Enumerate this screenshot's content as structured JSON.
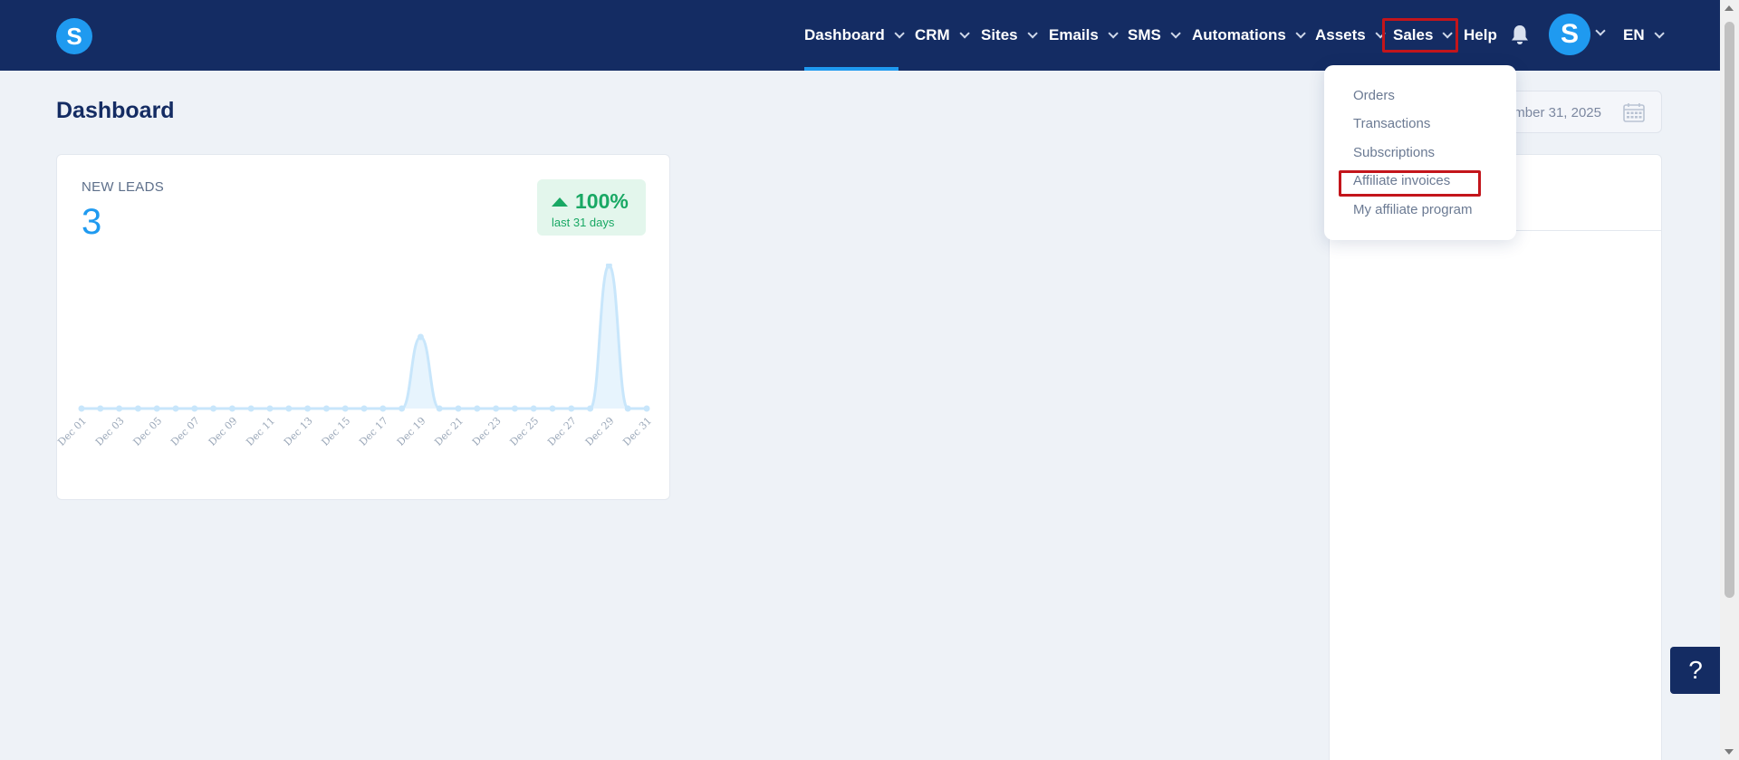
{
  "header": {
    "logo_letter": "S",
    "nav": [
      {
        "label": "Dashboard",
        "active": true
      },
      {
        "label": "CRM"
      },
      {
        "label": "Sites"
      },
      {
        "label": "Emails"
      },
      {
        "label": "SMS"
      },
      {
        "label": "Automations"
      },
      {
        "label": "Assets"
      },
      {
        "label": "Sales",
        "highlighted": true
      },
      {
        "label": "Help"
      }
    ],
    "avatar_letter": "S",
    "language": "EN"
  },
  "page": {
    "title": "Dashboard"
  },
  "date_range": {
    "visible_text": "ember 31, 2025"
  },
  "sales_menu": {
    "items": [
      {
        "label": "Orders"
      },
      {
        "label": "Transactions"
      },
      {
        "label": "Subscriptions"
      },
      {
        "label": "Affiliate invoices",
        "highlighted": true
      },
      {
        "label": "My affiliate program"
      }
    ]
  },
  "leads_card": {
    "label": "NEW LEADS",
    "value": "3",
    "change_percent": "100%",
    "change_period": "last 31 days",
    "change_direction": "up"
  },
  "help_button": {
    "label": "?"
  },
  "colors": {
    "navbar": "#142c63",
    "accent": "#1f9af0",
    "positive": "#19a864",
    "highlight": "#c3151b"
  },
  "chart_data": {
    "type": "area",
    "x": [
      "Dec 01",
      "Dec 02",
      "Dec 03",
      "Dec 04",
      "Dec 05",
      "Dec 06",
      "Dec 07",
      "Dec 08",
      "Dec 09",
      "Dec 10",
      "Dec 11",
      "Dec 12",
      "Dec 13",
      "Dec 14",
      "Dec 15",
      "Dec 16",
      "Dec 17",
      "Dec 18",
      "Dec 19",
      "Dec 20",
      "Dec 21",
      "Dec 22",
      "Dec 23",
      "Dec 24",
      "Dec 25",
      "Dec 26",
      "Dec 27",
      "Dec 28",
      "Dec 29",
      "Dec 30",
      "Dec 31"
    ],
    "tick_labels": [
      "Dec 01",
      "Dec 03",
      "Dec 05",
      "Dec 07",
      "Dec 09",
      "Dec 11",
      "Dec 13",
      "Dec 15",
      "Dec 17",
      "Dec 19",
      "Dec 21",
      "Dec 23",
      "Dec 25",
      "Dec 27",
      "Dec 29",
      "Dec 31"
    ],
    "series": [
      {
        "values": [
          0,
          0,
          0,
          0,
          0,
          0,
          0,
          0,
          0,
          0,
          0,
          0,
          0,
          0,
          0,
          0,
          0,
          0,
          1,
          0,
          0,
          0,
          0,
          0,
          0,
          0,
          0,
          0,
          2,
          0,
          0
        ]
      }
    ],
    "ylim": [
      0,
      2
    ],
    "grid": false
  }
}
